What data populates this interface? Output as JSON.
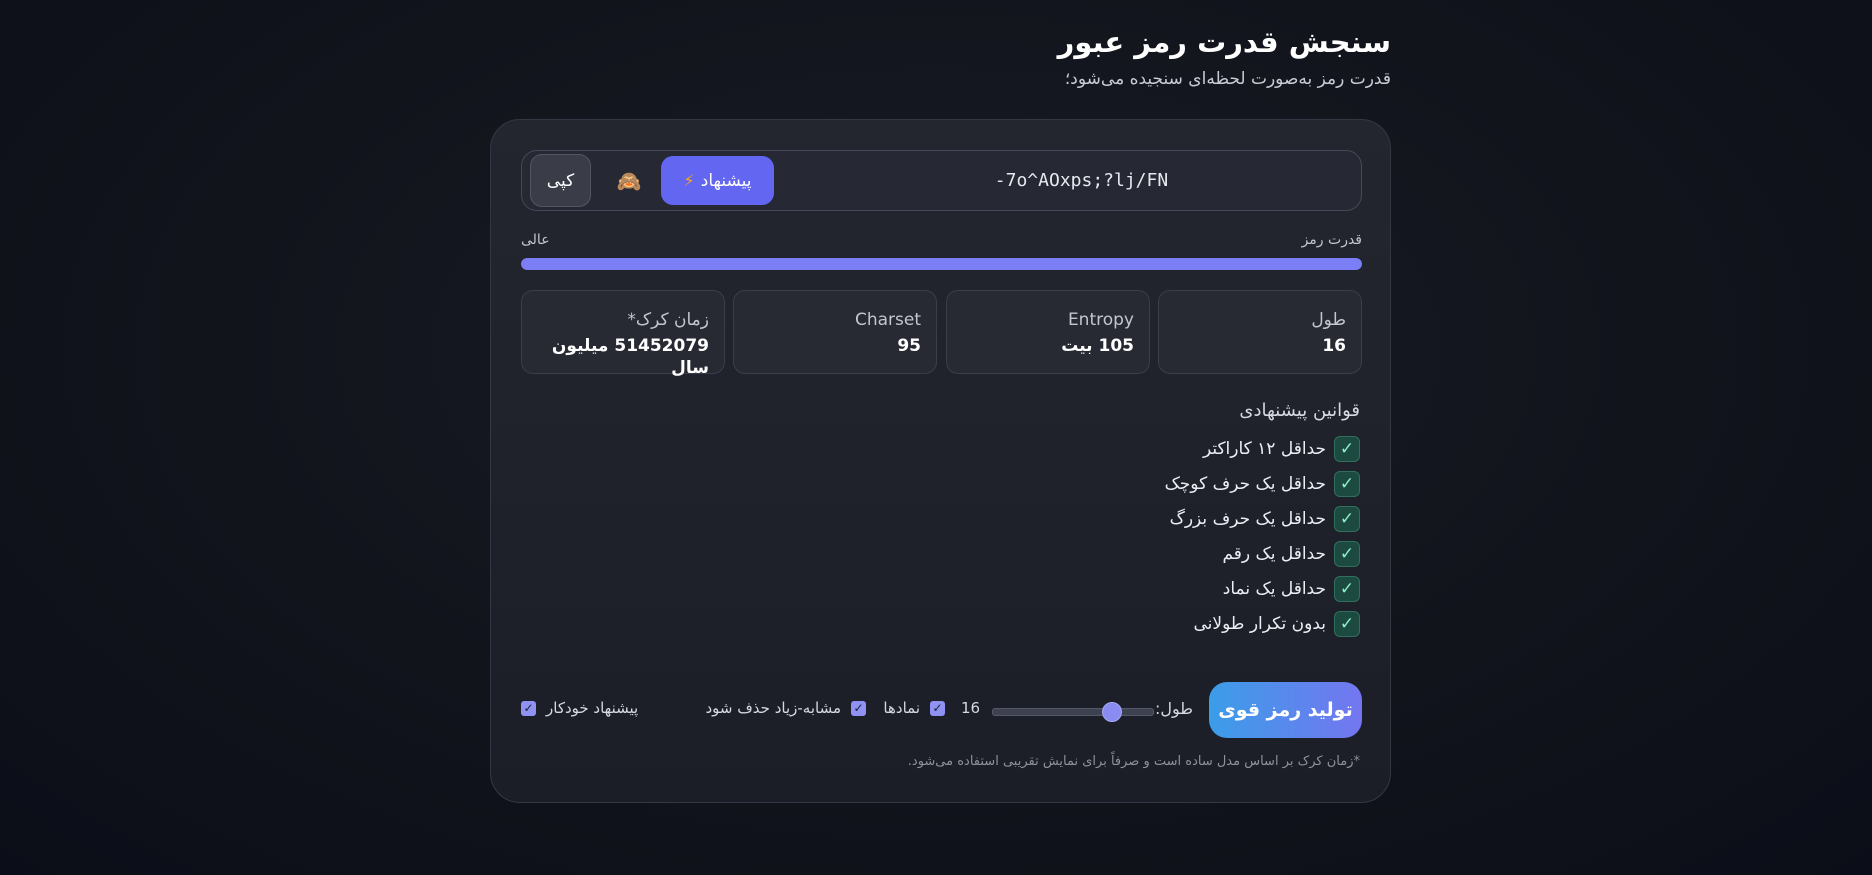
{
  "header": {
    "title": "سنجش قدرت رمز عبور",
    "subtitle": "قدرت رمز به‌صورت لحظه‌ای سنجیده می‌شود؛"
  },
  "password": {
    "value": "-7o^AOxps;?lj/FN",
    "suggest_label": "پیشنهاد",
    "suggest_icon": "bolt-icon",
    "visibility_icon": "see-no-evil-monkey-icon",
    "copy_label": "کپی"
  },
  "strength": {
    "label": "قدرت رمز",
    "value_label": "عالی",
    "fill_fraction": 1.0,
    "bar_color": "#7b7ef4"
  },
  "stats": {
    "length": {
      "label": "طول",
      "value": "16"
    },
    "entropy": {
      "label": "Entropy",
      "value": "105 بیت"
    },
    "charset": {
      "label": "Charset",
      "value": "95"
    },
    "crack_time": {
      "label": "زمان کرک*",
      "value": "51452079 میلیون سال"
    }
  },
  "rules": {
    "title": "قوانین پیشنهادی",
    "items": [
      {
        "label": "حداقل ۱۲ کاراکتر",
        "checked": true
      },
      {
        "label": "حداقل یک حرف کوچک",
        "checked": true
      },
      {
        "label": "حداقل یک حرف بزرگ",
        "checked": true
      },
      {
        "label": "حداقل یک رقم",
        "checked": true
      },
      {
        "label": "حداقل یک نماد",
        "checked": true
      },
      {
        "label": "بدون تکرار طولانی",
        "checked": true
      }
    ]
  },
  "controls": {
    "generate_label": "تولید رمز قوی",
    "length_label": "طول:",
    "length_value": "16",
    "length_slider_fraction": 0.74,
    "symbols_label": "نمادها",
    "symbols_checked": true,
    "exclude_similar_label": "مشابه-زیاد حذف شود",
    "exclude_similar_checked": true,
    "auto_suggest_label": "پیشنهاد خودکار",
    "auto_suggest_checked": true
  },
  "footnote": "*زمان کرک بر اساس مدل ساده است و صرفاً برای نمایش تقریبی استفاده می‌شود.",
  "colors": {
    "accent": "#6366f1",
    "check_green": "#1c4a40",
    "background": "#12141c"
  }
}
